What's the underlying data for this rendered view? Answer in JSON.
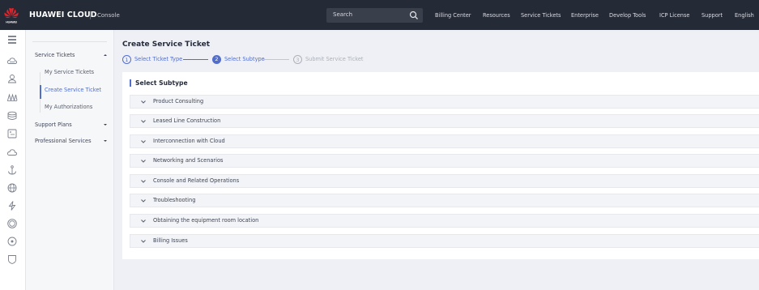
{
  "topbar": {
    "brand": "HUAWEI CLOUD",
    "console": "Console",
    "search_placeholder": "Search",
    "nav": [
      "Billing Center",
      "Resources",
      "Service Tickets",
      "Enterprise",
      "Develop Tools",
      "ICP License",
      "Support",
      "English"
    ],
    "bg_color": "#252a37"
  },
  "rail": {
    "icons": [
      "menu-icon",
      "cloud-icon",
      "user-group-icon",
      "network-icon",
      "database-icon",
      "server-icon",
      "cloud-outline-icon",
      "anchor-icon",
      "globe-icon",
      "lightning-icon",
      "region-icon",
      "circle-dot-icon",
      "shield-icon"
    ]
  },
  "sidemenu": {
    "service_tickets": "Service Tickets",
    "my_service_tickets": "My Service Tickets",
    "create_service_ticket": "Create Service Ticket",
    "my_authorizations": "My Authorizations",
    "support_plans": "Support Plans",
    "professional_services": "Professional Services"
  },
  "main": {
    "title": "Create Service Ticket",
    "steps": [
      {
        "num": "1",
        "label": "Select Ticket Type",
        "state": "done"
      },
      {
        "num": "2",
        "label": "Select Subtype",
        "state": "active"
      },
      {
        "num": "3",
        "label": "Submit Service Ticket",
        "state": "pending"
      }
    ],
    "section_title": "Select Subtype",
    "categories": [
      "Product Consulting",
      "Leased Line Construction",
      "Interconnection with Cloud",
      "Networking and Scenarios",
      "Console and Related Operations",
      "Troubleshooting",
      "Obtaining the equipment room location",
      "Billing Issues"
    ],
    "accent_color": "#526ecc"
  }
}
